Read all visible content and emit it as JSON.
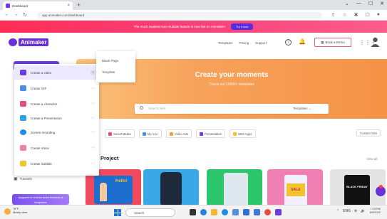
{
  "browser": {
    "tab_title": "Dashboard",
    "tab_close": "×",
    "new_tab": "+",
    "url": "app.animaker.com/dashboard",
    "window_controls": [
      "⌄",
      "—",
      "☐",
      "✕"
    ],
    "nav_back": "←",
    "nav_forward": "→",
    "nav_reload": "↻",
    "toolbar_icons": [
      "⇪",
      "☆",
      "✱",
      "☐",
      "●"
    ]
  },
  "banner": {
    "text": "The much awaited Auto-Subtitle feature is now live on Animaker!",
    "button_label": "Try it now"
  },
  "header": {
    "logo_text": "Animaker",
    "nav": [
      "Templates",
      "Pricing",
      "Support"
    ],
    "help_label": "?",
    "bell_label": "🔔",
    "demo_label": "Book a Demo",
    "demo_icon": "▦",
    "grid_label": "⋮⋮⋮"
  },
  "menu": {
    "items": [
      {
        "label": "Create a video",
        "chevron": "›",
        "active": true,
        "color": "#6c3ce0"
      },
      {
        "label": "Create GIF",
        "chevron": "› ›",
        "active": false,
        "color": "#4a90e2"
      },
      {
        "label": "Create a character",
        "chevron": "› ›",
        "active": false,
        "color": "#e94e77"
      },
      {
        "label": "Create a Presentation",
        "chevron": "› ›",
        "active": false,
        "color": "#2fa3e6"
      },
      {
        "label": "Screen recording",
        "chevron": "› ›",
        "active": false,
        "color": "#1f8fe5"
      },
      {
        "label": "Create Voice",
        "chevron": "› ›",
        "active": false,
        "color": "#f27fb2"
      },
      {
        "label": "Create Subtitle",
        "chevron": "› ›",
        "active": false,
        "color": "#f2c230"
      }
    ]
  },
  "submenu": {
    "items": [
      "Blank Page",
      "Template"
    ]
  },
  "sidebar": {
    "tutorials_label": "Tutorials",
    "upgrade_label": "Upgrade to Unlock more features & templates"
  },
  "hero": {
    "title": "Create your moments",
    "subtitle": "Check out 10000+ templates"
  },
  "search": {
    "placeholder": "Search here",
    "filter_label": "Templates ⌄"
  },
  "chips": [
    {
      "label": "Social Media",
      "color": "#e94e77"
    },
    {
      "label": "My Icon",
      "color": "#4a90e2"
    },
    {
      "label": "Video Ads",
      "color": "#f2a33a"
    },
    {
      "label": "Presentation",
      "color": "#6c3ce0"
    },
    {
      "label": "Web Apps",
      "color": "#f2c230"
    }
  ],
  "custom_size_label": "Custom Size",
  "project": {
    "title": "Project",
    "view_all": "View all",
    "thumb_texts": [
      "Hello!",
      "SALE",
      "BLACK FRIDAY"
    ]
  },
  "taskbar": {
    "weather_temp": "78°F",
    "weather_desc": "Mostly clear",
    "search_label": "Search",
    "tray": [
      "⌃",
      "ENG",
      "⊜",
      "🔊"
    ],
    "time": "1:10 PM",
    "date": "8/9/2023"
  },
  "colors": {
    "brand_purple": "#6c3ce0",
    "banner_pink": "#ff2d55",
    "hero_orange": "#f6a15a"
  }
}
